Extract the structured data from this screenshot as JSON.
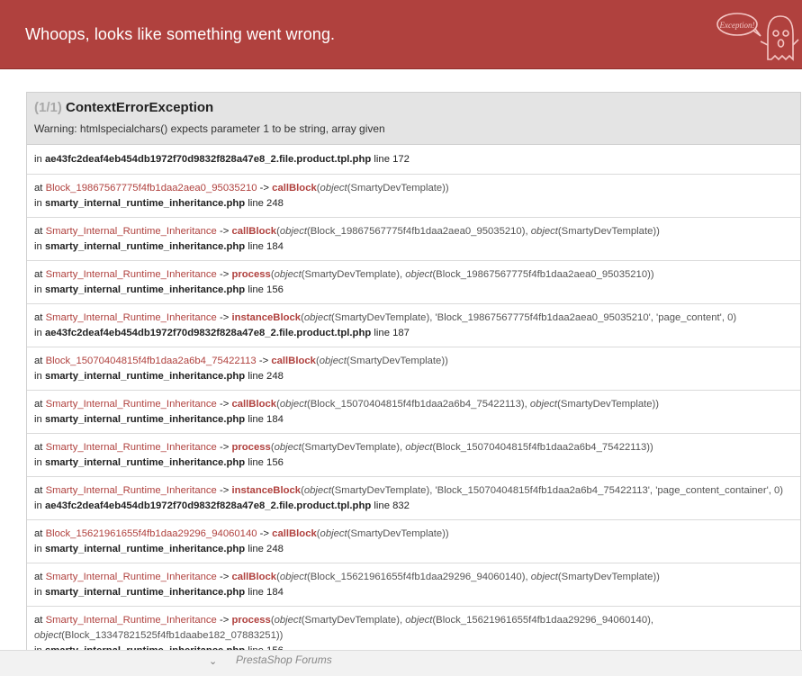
{
  "header": {
    "title": "Whoops, looks like something went wrong.",
    "logo_text": "Exception!",
    "bg_color": "#b0413e"
  },
  "exception": {
    "count": "(1/1)",
    "name": "ContextErrorException",
    "message": "Warning: htmlspecialchars() expects parameter 1 to be string, array given"
  },
  "trace": {
    "first": {
      "in": "in",
      "file": "ae43fc2deaf4eb454db1972f70d9832f828a47e8_2.file.product.tpl.php",
      "line": "line 172"
    },
    "frames": [
      {
        "cls": "Block_19867567775f4fb1daa2aea0_95035210",
        "fn": "callBlock",
        "args_html": "<i>object</i>(SmartyDevTemplate)",
        "file": "smarty_internal_runtime_inheritance.php",
        "line": "line 248"
      },
      {
        "cls": "Smarty_Internal_Runtime_Inheritance",
        "fn": "callBlock",
        "args_html": "<i>object</i>(Block_19867567775f4fb1daa2aea0_95035210), <i>object</i>(SmartyDevTemplate)",
        "file": "smarty_internal_runtime_inheritance.php",
        "line": "line 184"
      },
      {
        "cls": "Smarty_Internal_Runtime_Inheritance",
        "fn": "process",
        "args_html": "<i>object</i>(SmartyDevTemplate), <i>object</i>(Block_19867567775f4fb1daa2aea0_95035210)",
        "file": "smarty_internal_runtime_inheritance.php",
        "line": "line 156"
      },
      {
        "cls": "Smarty_Internal_Runtime_Inheritance",
        "fn": "instanceBlock",
        "args_html": "<i>object</i>(SmartyDevTemplate), 'Block_19867567775f4fb1daa2aea0_95035210', 'page_content', 0",
        "file": "ae43fc2deaf4eb454db1972f70d9832f828a47e8_2.file.product.tpl.php",
        "line": "line 187"
      },
      {
        "cls": "Block_15070404815f4fb1daa2a6b4_75422113",
        "fn": "callBlock",
        "args_html": "<i>object</i>(SmartyDevTemplate)",
        "file": "smarty_internal_runtime_inheritance.php",
        "line": "line 248"
      },
      {
        "cls": "Smarty_Internal_Runtime_Inheritance",
        "fn": "callBlock",
        "args_html": "<i>object</i>(Block_15070404815f4fb1daa2a6b4_75422113), <i>object</i>(SmartyDevTemplate)",
        "file": "smarty_internal_runtime_inheritance.php",
        "line": "line 184"
      },
      {
        "cls": "Smarty_Internal_Runtime_Inheritance",
        "fn": "process",
        "args_html": "<i>object</i>(SmartyDevTemplate), <i>object</i>(Block_15070404815f4fb1daa2a6b4_75422113)",
        "file": "smarty_internal_runtime_inheritance.php",
        "line": "line 156"
      },
      {
        "cls": "Smarty_Internal_Runtime_Inheritance",
        "fn": "instanceBlock",
        "args_html": "<i>object</i>(SmartyDevTemplate), 'Block_15070404815f4fb1daa2a6b4_75422113', 'page_content_container', 0",
        "file": "ae43fc2deaf4eb454db1972f70d9832f828a47e8_2.file.product.tpl.php",
        "line": "line 832"
      },
      {
        "cls": "Block_15621961655f4fb1daa29296_94060140",
        "fn": "callBlock",
        "args_html": "<i>object</i>(SmartyDevTemplate)",
        "file": "smarty_internal_runtime_inheritance.php",
        "line": "line 248"
      },
      {
        "cls": "Smarty_Internal_Runtime_Inheritance",
        "fn": "callBlock",
        "args_html": "<i>object</i>(Block_15621961655f4fb1daa29296_94060140), <i>object</i>(SmartyDevTemplate)",
        "file": "smarty_internal_runtime_inheritance.php",
        "line": "line 184"
      },
      {
        "cls": "Smarty_Internal_Runtime_Inheritance",
        "fn": "process",
        "args_html": "<i>object</i>(SmartyDevTemplate), <i>object</i>(Block_15621961655f4fb1daa29296_94060140), <i>object</i>(Block_13347821525f4fb1daabe182_07883251)",
        "file": "smarty_internal_runtime_inheritance.php",
        "line": "line 156"
      }
    ],
    "at_word": "at",
    "in_word": "in",
    "arrow": "->"
  },
  "footer": {
    "text": "PrestaShop Forums",
    "chevron": "⌄"
  }
}
